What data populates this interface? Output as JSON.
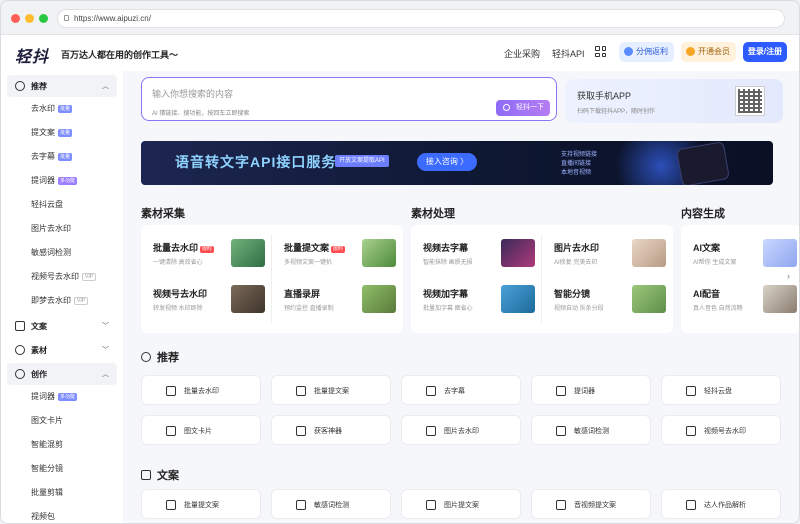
{
  "browser": {
    "url": "https://www.aipuzi.cn/"
  },
  "header": {
    "logo": "轻抖",
    "slogan": "百万达人都在用的创作工具～",
    "nav": [
      "企业采购",
      "轻抖API"
    ],
    "invite": "分佣返利",
    "vip": "开通会员",
    "login": "登录/注册"
  },
  "sidebar": {
    "groups": [
      {
        "label": "推荐",
        "expanded": true,
        "items": [
          {
            "label": "去水印",
            "badge": "批量",
            "badge_type": "blue"
          },
          {
            "label": "提文案",
            "badge": "批量",
            "badge_type": "blue"
          },
          {
            "label": "去字幕",
            "badge": "批量",
            "badge_type": "blue"
          },
          {
            "label": "提词器",
            "badge": "多功能",
            "badge_type": "purple"
          },
          {
            "label": "轻抖云盘",
            "badge": "",
            "badge_type": ""
          },
          {
            "label": "图片去水印",
            "badge": "",
            "badge_type": ""
          },
          {
            "label": "敏感词检测",
            "badge": "",
            "badge_type": ""
          },
          {
            "label": "视频号去水印",
            "badge": "VIP",
            "badge_type": "gray"
          },
          {
            "label": "即梦去水印",
            "badge": "VIP",
            "badge_type": "gray"
          }
        ]
      },
      {
        "label": "文案",
        "expanded": false,
        "items": []
      },
      {
        "label": "素材",
        "expanded": false,
        "items": []
      },
      {
        "label": "创作",
        "expanded": true,
        "items": [
          {
            "label": "提词器",
            "badge": "多功能",
            "badge_type": "blue"
          },
          {
            "label": "图文卡片",
            "badge": "",
            "badge_type": ""
          },
          {
            "label": "智能混剪",
            "badge": "",
            "badge_type": ""
          },
          {
            "label": "智能分镜",
            "badge": "",
            "badge_type": ""
          },
          {
            "label": "批量剪辑",
            "badge": "",
            "badge_type": ""
          },
          {
            "label": "视频包",
            "badge": "",
            "badge_type": ""
          }
        ]
      }
    ]
  },
  "search": {
    "placeholder": "输入你想搜索的内容",
    "hint": "AI 猜链接、搜功能，按回车立即搜索",
    "button": "轻抖一下"
  },
  "app_card": {
    "title": "获取手机APP",
    "subtitle": "扫码下载轻抖APP，随时创作"
  },
  "banner": {
    "title": "语音转文字API接口服务",
    "tag": "开放文案提取API",
    "button": "接入咨询 〉",
    "side_text": [
      "支持视频链接",
      "直播间链接",
      "本地音视频"
    ]
  },
  "categories": [
    {
      "title": "素材采集",
      "features": [
        {
          "name": "批量去水印",
          "hot": "限时",
          "desc": "一键清除 高效省心"
        },
        {
          "name": "批量提文案",
          "hot": "限时",
          "desc": "多视频文案一键扒"
        },
        {
          "name": "视频号去水印",
          "hot": "",
          "desc": "转发视频 水印即除"
        },
        {
          "name": "直播录屏",
          "hot": "",
          "desc": "预约监控 直播录制"
        }
      ]
    },
    {
      "title": "素材处理",
      "features": [
        {
          "name": "视频去字幕",
          "hot": "",
          "desc": "智能抹除 画质无损"
        },
        {
          "name": "图片去水印",
          "hot": "",
          "desc": "AI修复 完美去印"
        },
        {
          "name": "视频加字幕",
          "hot": "",
          "desc": "批量加字幕 图省心"
        },
        {
          "name": "智能分镜",
          "hot": "",
          "desc": "视频自动 拆条分段"
        }
      ]
    },
    {
      "title": "内容生成",
      "features": [
        {
          "name": "AI文案",
          "hot": "",
          "desc": "AI帮你 生成文案"
        },
        {
          "name": "AI配音",
          "hot": "",
          "desc": "真人音色 自然流畅"
        }
      ]
    }
  ],
  "recommend": {
    "title": "推荐",
    "tools": [
      "批量去水印",
      "批量提文案",
      "去字幕",
      "提词器",
      "轻抖云盘",
      "图文卡片",
      "获客神器",
      "图片去水印",
      "敏感词检测",
      "视频号去水印"
    ]
  },
  "copywriting": {
    "title": "文案",
    "tools": [
      "批量提文案",
      "敏感词检测",
      "图片提文案",
      "音视频提文案",
      "达人作品解析"
    ]
  },
  "colors": {
    "accent": "#2d5bff",
    "search_border": "#8a76f5",
    "banner_bg": "#0e1732"
  }
}
